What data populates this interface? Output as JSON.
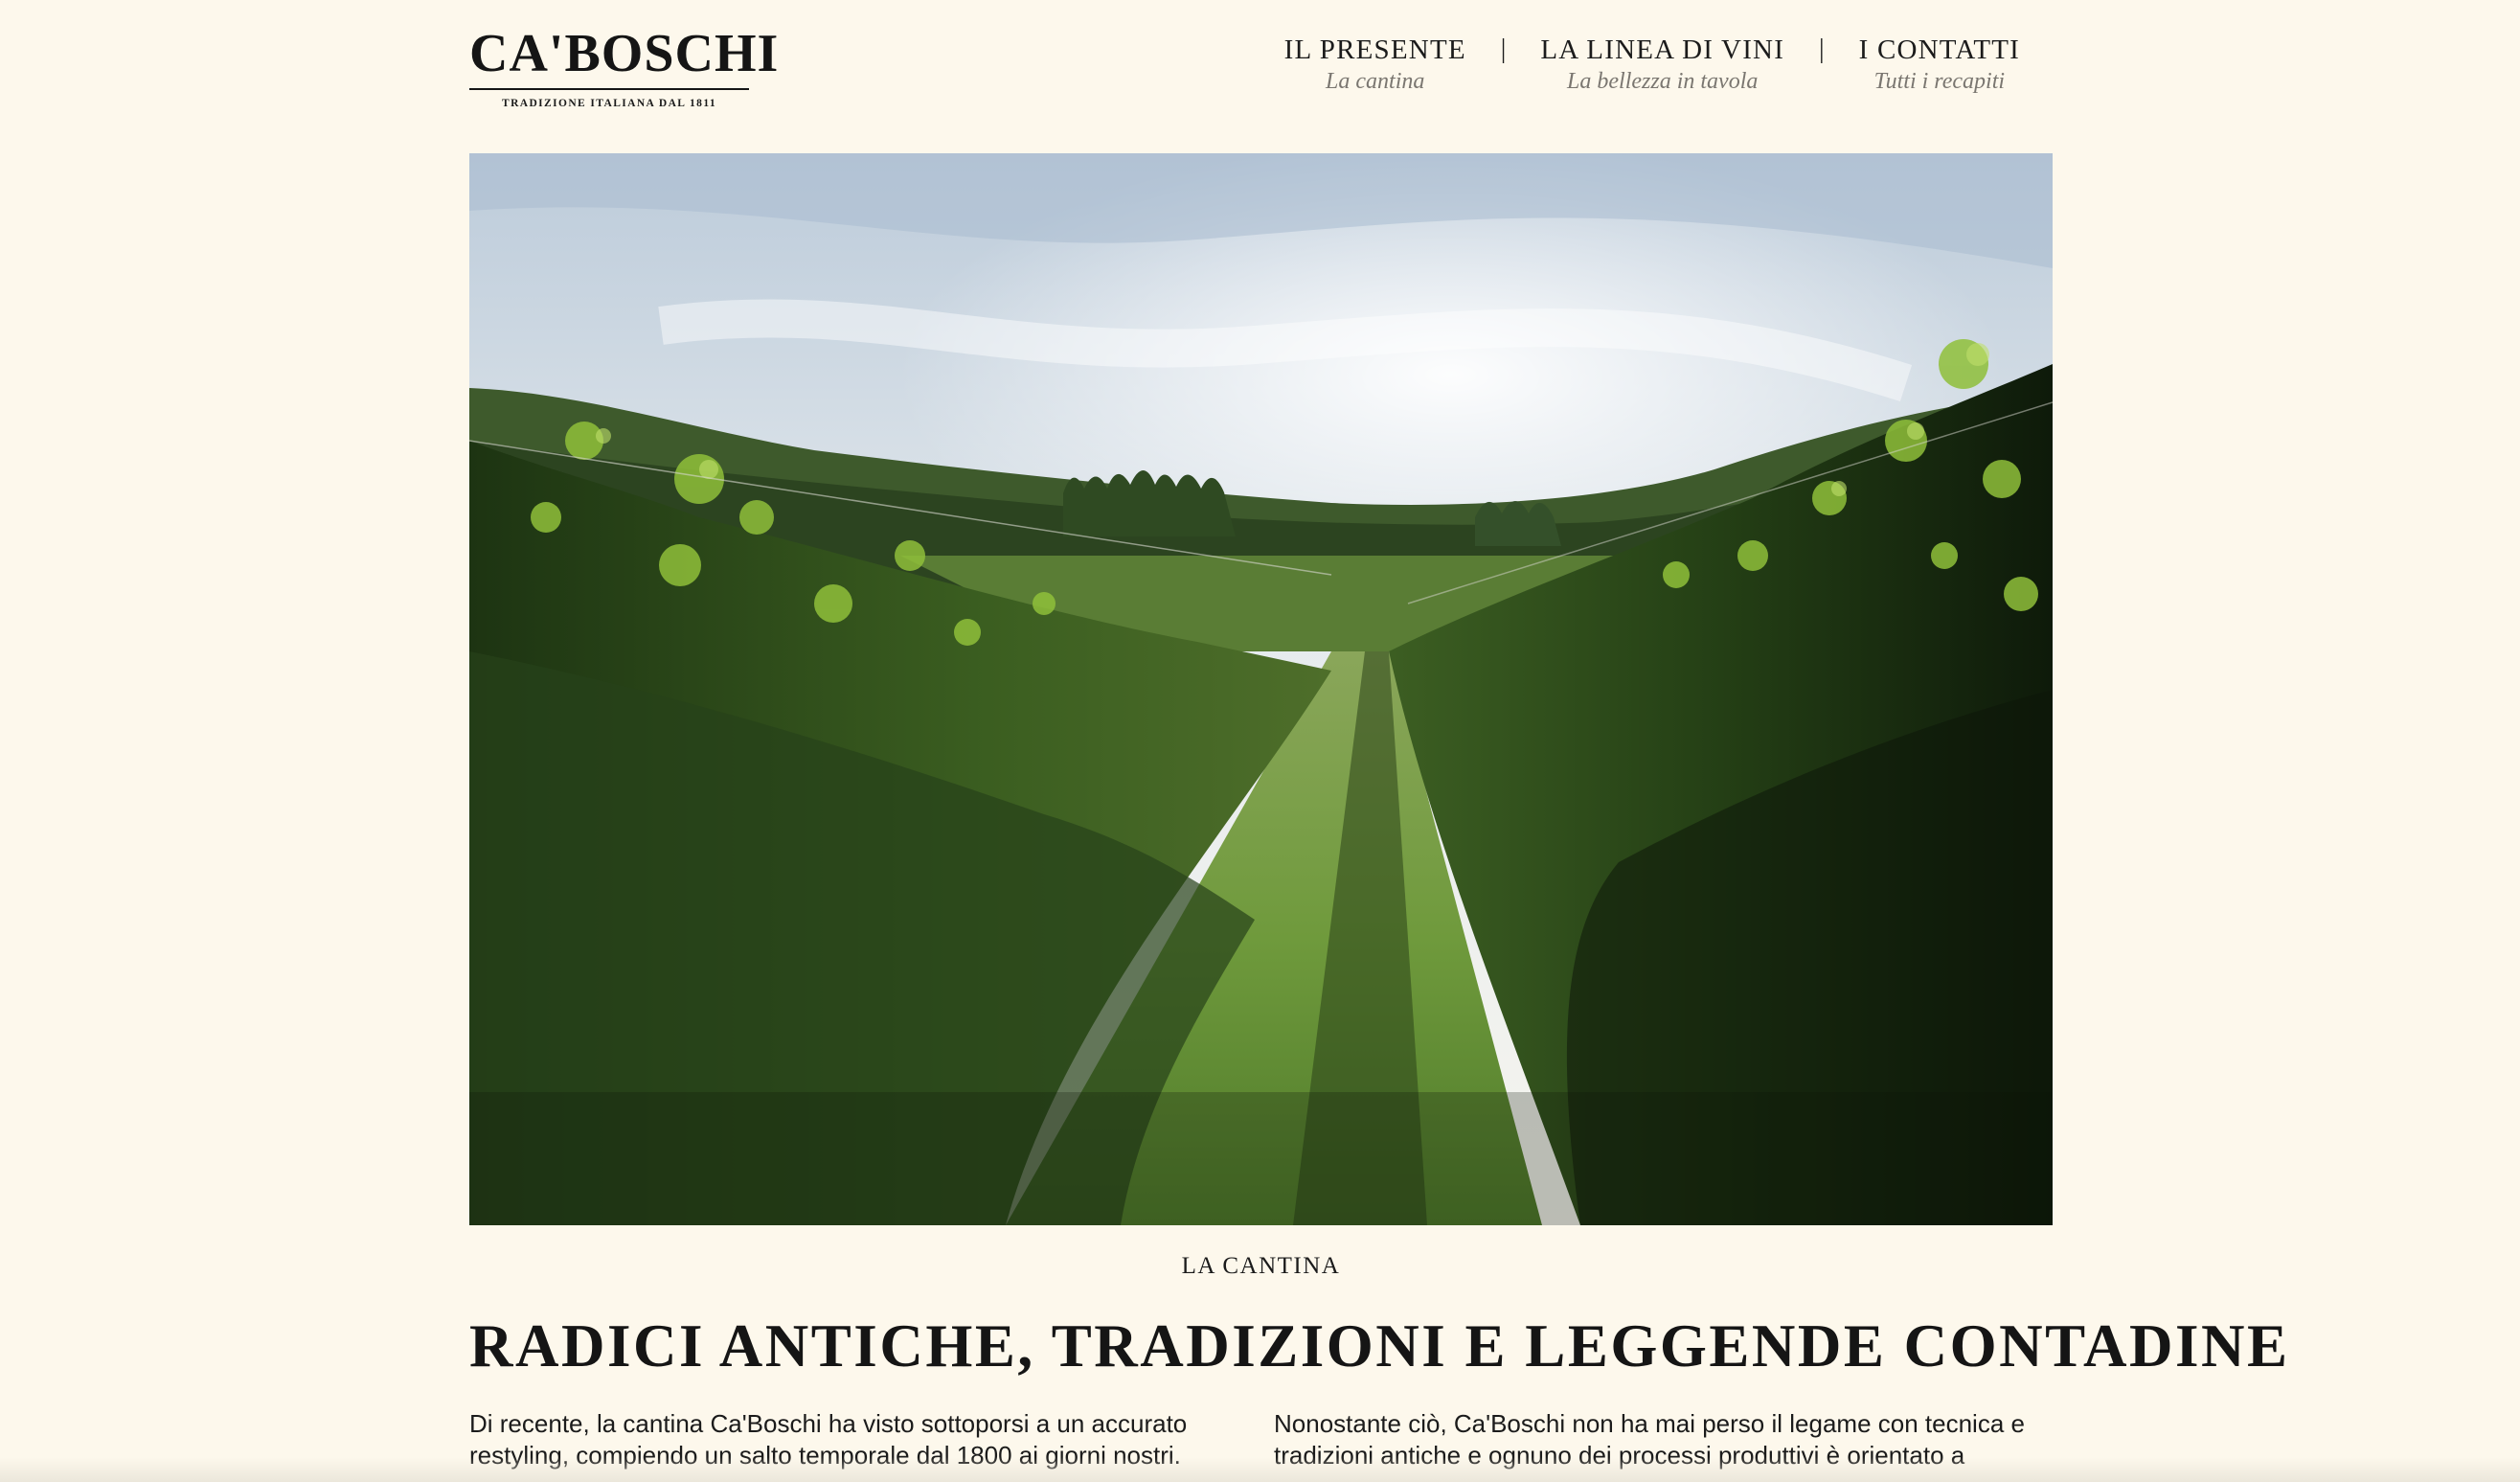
{
  "header": {
    "logo_text": "CA'BOSCHI",
    "logo_tagline": "TRADIZIONE ITALIANA DAL 1811",
    "nav": [
      {
        "title": "IL PRESENTE",
        "subtitle": "La cantina"
      },
      {
        "title": "LA LINEA DI VINI",
        "subtitle": "La bellezza in tavola"
      },
      {
        "title": "I CONTATTI",
        "subtitle": "Tutti i recapiti"
      }
    ],
    "separator": "|"
  },
  "hero": {
    "image_name": "vineyard-rows-photo"
  },
  "content": {
    "eyebrow": "LA CANTINA",
    "headline": "RADICI ANTICHE, TRADIZIONI E LEGGENDE CONTADINE",
    "left_column": [
      "Di recente, la cantina Ca'Boschi ha visto sottoporsi a un accurato",
      "restyling, compiendo un salto temporale dal 1800 ai giorni nostri."
    ],
    "right_column": [
      "Nonostante ciò, Ca'Boschi non ha mai perso  il legame con tecnica e",
      "tradizioni antiche  e ognuno dei processi produttivi è orientato  a"
    ]
  },
  "colors": {
    "background": "#fdf8ec",
    "text": "#1b1b1b",
    "nav_subtitle": "#7a7670"
  }
}
